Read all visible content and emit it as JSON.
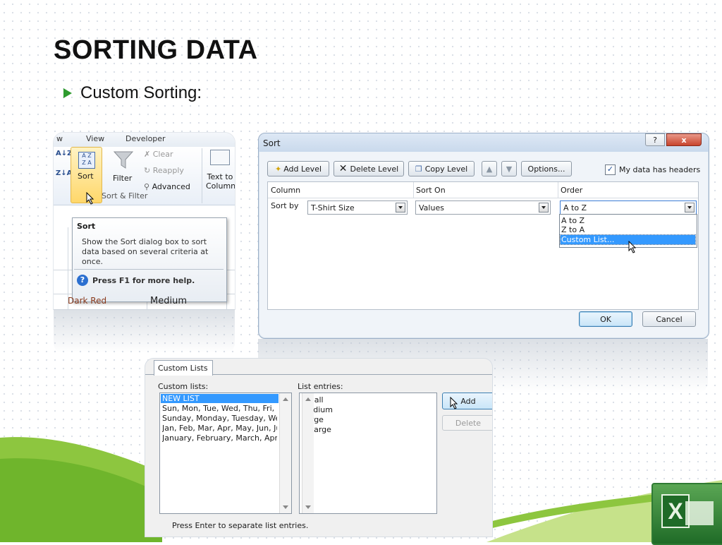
{
  "slide": {
    "title": "SORTING DATA",
    "bullet": "Custom Sorting:"
  },
  "ribbon": {
    "tabs": [
      "w",
      "View",
      "Developer"
    ],
    "sort_label": "Sort",
    "filter_label": "Filter",
    "clear_label": "Clear",
    "reapply_label": "Reapply",
    "advanced_label": "Advanced",
    "text_to_label_1": "Text to",
    "text_to_label_2": "Column",
    "group_label": "Sort & Filter",
    "az": "A↓Z",
    "za": "Z↓A",
    "tooltip": {
      "title": "Sort",
      "body": "Show the Sort dialog box to sort data based on several criteria at once.",
      "help": "Press F1 for more help."
    },
    "cell_a": "Dark Red",
    "cell_b": "Medium"
  },
  "sort_dialog": {
    "title": "Sort",
    "add_level": "Add Level",
    "delete_level": "Delete Level",
    "copy_level": "Copy Level",
    "options": "Options...",
    "my_data_headers": "My data has headers",
    "headers_checked": true,
    "col_column": "Column",
    "col_sort_on": "Sort On",
    "col_order": "Order",
    "sort_by": "Sort by",
    "column_value": "T-Shirt Size",
    "sort_on_value": "Values",
    "order_value": "A to Z",
    "order_options": [
      "A to Z",
      "Z to A",
      "Custom List..."
    ],
    "ok": "OK",
    "cancel": "Cancel",
    "help_glyph": "?",
    "close_glyph": "x"
  },
  "custom_lists": {
    "tab": "Custom Lists",
    "lists_label": "Custom lists:",
    "entries_label": "List entries:",
    "lists": [
      "NEW LIST",
      "Sun, Mon, Tue, Wed, Thu, Fri, Sat",
      "Sunday, Monday, Tuesday, Wednesday",
      "Jan, Feb, Mar, Apr, May, Jun, Jul",
      "January, February, March, April"
    ],
    "entries": [
      "Small",
      "Medium",
      "Large",
      "X-Large"
    ],
    "add": "Add",
    "delete": "Delete",
    "footer": "Press Enter to separate list entries."
  },
  "colors": {
    "accent_green": "#2e9b2e",
    "selection_blue": "#3399ff"
  }
}
